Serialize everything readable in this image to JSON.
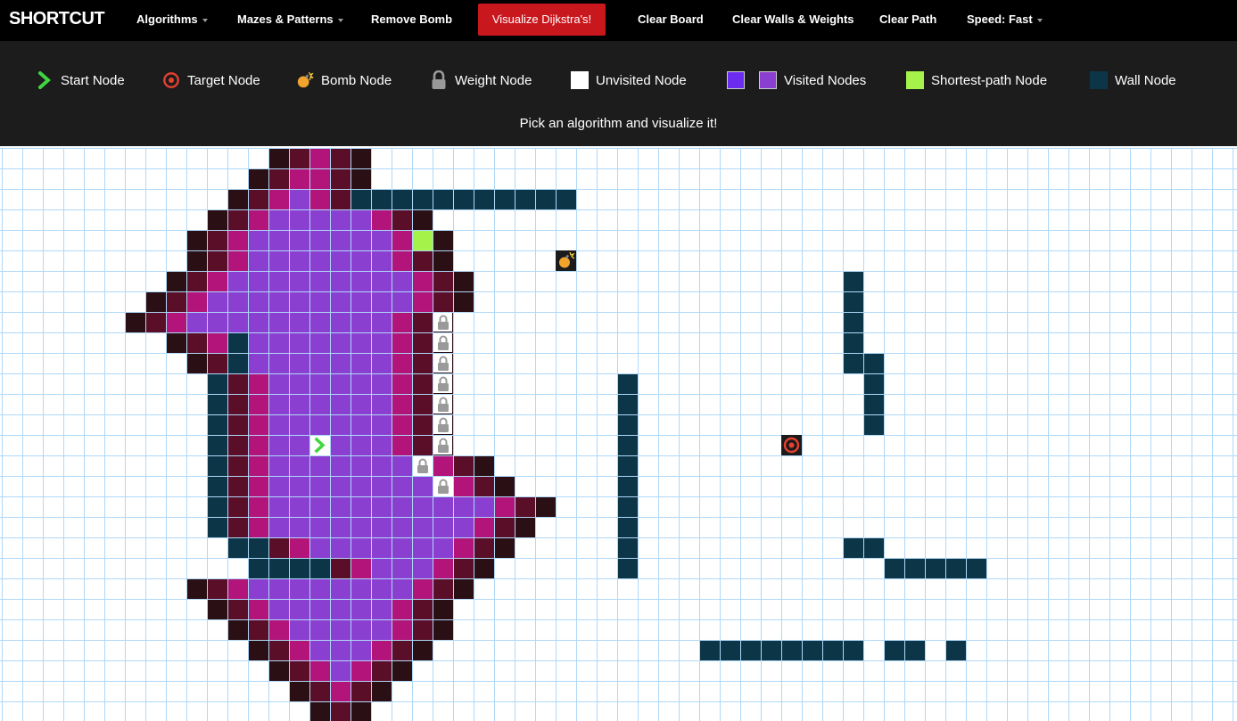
{
  "navbar": {
    "brand": "SHORTCUT",
    "items": [
      {
        "label": "Algorithms",
        "dropdown": true
      },
      {
        "label": "Mazes & Patterns",
        "dropdown": true
      },
      {
        "label": "Remove Bomb",
        "dropdown": false
      },
      {
        "label": "Clear Board",
        "dropdown": false
      },
      {
        "label": "Clear Walls & Weights",
        "dropdown": false
      },
      {
        "label": "Clear Path",
        "dropdown": false
      },
      {
        "label": "Speed: Fast",
        "dropdown": true
      }
    ],
    "visualize_label": "Visualize Dijkstra's!"
  },
  "legend": {
    "start": "Start Node",
    "target": "Target Node",
    "bomb": "Bomb Node",
    "weight": "Weight Node",
    "unvisited": "Unvisited Node",
    "visited": "Visited Nodes",
    "shortest": "Shortest-path Node",
    "wall": "Wall Node"
  },
  "hint": "Pick an algorithm and visualize it!",
  "colors": {
    "navbar_bg": "#000000",
    "legend_bg": "#1c1c1c",
    "visualize_button": "#c9171e",
    "visited": "#8b3fd1",
    "visited_legend_alt": "#6c2cf0",
    "visited_frontier": "#b21479",
    "visited_edge": "#5a0e28",
    "visited_outer": "#2a0f14",
    "shortest_path": "#a5f24a",
    "wall": "#0c3547",
    "grid_line": "#afd8f8",
    "start_icon": "#3fd63f",
    "target_icon": "#e8402e",
    "bomb_icon": "#f2a32c"
  },
  "board": {
    "cols": 61,
    "rows": 28,
    "start": [
      15,
      14
    ],
    "target": [
      38,
      14
    ],
    "bomb": [
      27,
      5
    ],
    "weights": [
      [
        21,
        8
      ],
      [
        21,
        9
      ],
      [
        21,
        10
      ],
      [
        21,
        11
      ],
      [
        21,
        12
      ],
      [
        21,
        13
      ],
      [
        21,
        14
      ],
      [
        20,
        15
      ],
      [
        21,
        16
      ]
    ],
    "shortest": [
      [
        20,
        4
      ]
    ],
    "walls": [
      [
        17,
        2
      ],
      [
        18,
        2
      ],
      [
        19,
        2
      ],
      [
        20,
        2
      ],
      [
        21,
        2
      ],
      [
        22,
        2
      ],
      [
        23,
        2
      ],
      [
        24,
        2
      ],
      [
        25,
        2
      ],
      [
        26,
        2
      ],
      [
        27,
        2
      ],
      [
        41,
        6
      ],
      [
        41,
        7
      ],
      [
        41,
        8
      ],
      [
        41,
        9
      ],
      [
        41,
        10
      ],
      [
        42,
        10
      ],
      [
        42,
        11
      ],
      [
        42,
        12
      ],
      [
        42,
        13
      ],
      [
        30,
        11
      ],
      [
        30,
        12
      ],
      [
        30,
        13
      ],
      [
        30,
        14
      ],
      [
        30,
        15
      ],
      [
        30,
        16
      ],
      [
        30,
        17
      ],
      [
        30,
        18
      ],
      [
        30,
        19
      ],
      [
        30,
        20
      ],
      [
        11,
        9
      ],
      [
        11,
        10
      ],
      [
        10,
        11
      ],
      [
        10,
        12
      ],
      [
        10,
        13
      ],
      [
        10,
        14
      ],
      [
        10,
        15
      ],
      [
        10,
        16
      ],
      [
        10,
        17
      ],
      [
        10,
        18
      ],
      [
        11,
        19
      ],
      [
        12,
        19
      ],
      [
        12,
        20
      ],
      [
        13,
        20
      ],
      [
        14,
        20
      ],
      [
        15,
        20
      ],
      [
        41,
        19
      ],
      [
        42,
        19
      ],
      [
        43,
        20
      ],
      [
        44,
        20
      ],
      [
        45,
        20
      ],
      [
        46,
        20
      ],
      [
        47,
        20
      ],
      [
        34,
        24
      ],
      [
        35,
        24
      ],
      [
        36,
        24
      ],
      [
        37,
        24
      ],
      [
        38,
        24
      ],
      [
        39,
        24
      ],
      [
        40,
        24
      ],
      [
        41,
        24
      ],
      [
        43,
        24
      ],
      [
        44,
        24
      ],
      [
        46,
        24
      ]
    ],
    "visited_rows": [
      [
        0,
        14,
        16
      ],
      [
        1,
        13,
        16
      ],
      [
        2,
        12,
        16
      ],
      [
        3,
        11,
        19
      ],
      [
        4,
        10,
        20
      ],
      [
        5,
        10,
        20
      ],
      [
        6,
        9,
        21
      ],
      [
        7,
        8,
        21
      ],
      [
        8,
        7,
        20
      ],
      [
        9,
        9,
        20
      ],
      [
        10,
        10,
        20
      ],
      [
        11,
        11,
        20
      ],
      [
        12,
        11,
        20
      ],
      [
        13,
        11,
        20
      ],
      [
        14,
        11,
        20
      ],
      [
        15,
        11,
        22
      ],
      [
        16,
        11,
        23
      ],
      [
        17,
        11,
        25
      ],
      [
        18,
        11,
        24
      ],
      [
        19,
        13,
        23
      ],
      [
        20,
        16,
        22
      ],
      [
        21,
        10,
        21
      ],
      [
        22,
        11,
        20
      ],
      [
        23,
        12,
        20
      ],
      [
        24,
        13,
        19
      ],
      [
        25,
        14,
        18
      ],
      [
        26,
        15,
        17
      ],
      [
        27,
        16,
        16
      ]
    ]
  }
}
